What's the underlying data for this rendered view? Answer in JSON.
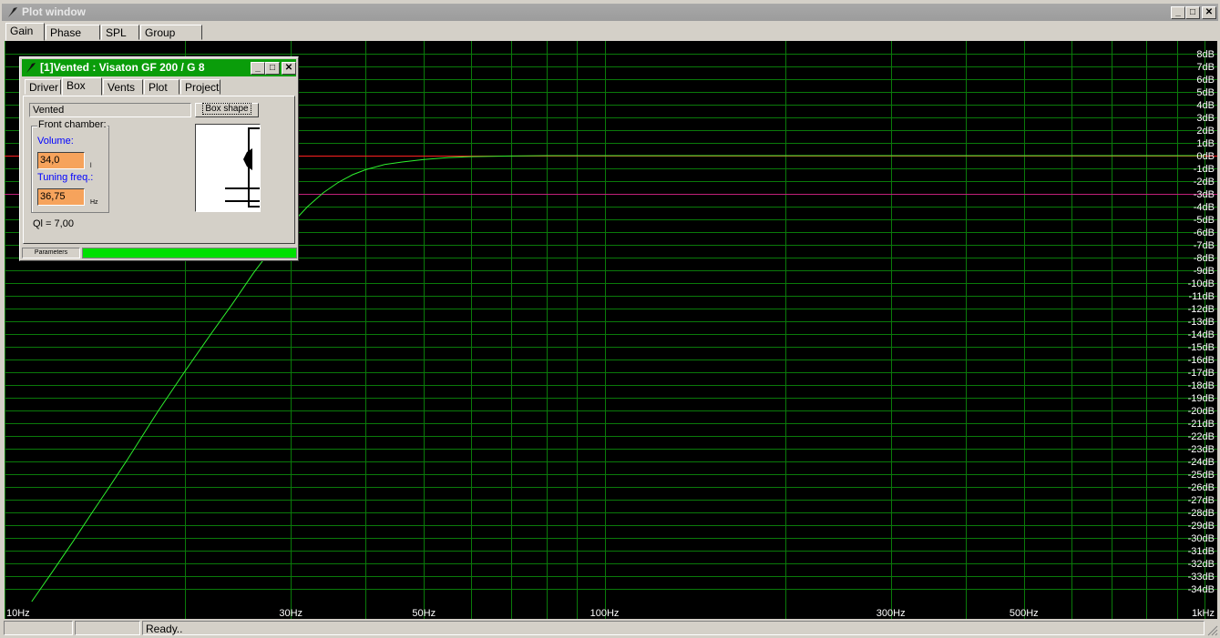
{
  "window": {
    "title": "Plot window",
    "min_label": "_",
    "max_label": "□",
    "close_label": "✕"
  },
  "tabs": [
    {
      "label": "Gain"
    },
    {
      "label": "Phase plot"
    },
    {
      "label": "SPL"
    },
    {
      "label": "Group delay"
    }
  ],
  "statusbar": {
    "panel3": "Ready.."
  },
  "child": {
    "title": "[1]Vented : Visaton GF 200 / G 8",
    "tabs": [
      {
        "label": "Driver"
      },
      {
        "label": "Box"
      },
      {
        "label": "Vents"
      },
      {
        "label": "Plot"
      },
      {
        "label": "Project"
      }
    ],
    "box_type": "Vented",
    "box_shape_button": "Box shape",
    "front_chamber_label": "Front chamber:",
    "volume_label": "Volume:",
    "volume_value": "34,0",
    "volume_unit": "l",
    "tuning_label": "Tuning freq.:",
    "tuning_value": "36,75",
    "tuning_unit": "Hz",
    "ql_text": "Ql = 7,00",
    "status_label": "Parameters"
  },
  "chart_data": {
    "type": "line",
    "x_scale": "log",
    "xlim": [
      10,
      1000
    ],
    "ylim": [
      -35,
      9
    ],
    "x_tick_labels": [
      {
        "x": 10,
        "label": "10Hz"
      },
      {
        "x": 30,
        "label": "30Hz"
      },
      {
        "x": 50,
        "label": "50Hz"
      },
      {
        "x": 100,
        "label": "100Hz"
      },
      {
        "x": 300,
        "label": "300Hz"
      },
      {
        "x": 500,
        "label": "500Hz"
      },
      {
        "x": 1000,
        "label": "1kHz"
      }
    ],
    "y_tick_labels": [
      "8dB",
      "7dB",
      "6dB",
      "5dB",
      "4dB",
      "3dB",
      "2dB",
      "1dB",
      "0dB",
      "-1dB",
      "-2dB",
      "-3dB",
      "-4dB",
      "-5dB",
      "-6dB",
      "-7dB",
      "-8dB",
      "-9dB",
      "-10dB",
      "-11dB",
      "-12dB",
      "-13dB",
      "-14dB",
      "-15dB",
      "-16dB",
      "-17dB",
      "-18dB",
      "-19dB",
      "-20dB",
      "-21dB",
      "-22dB",
      "-23dB",
      "-24dB",
      "-25dB",
      "-26dB",
      "-27dB",
      "-28dB",
      "-29dB",
      "-30dB",
      "-31dB",
      "-32dB",
      "-33dB",
      "-34dB"
    ],
    "reference_lines": [
      {
        "y": 0,
        "color": "#ff2020"
      },
      {
        "y": -3,
        "color": "#c0207a"
      }
    ],
    "grid": true,
    "colors": {
      "background": "#000000",
      "grid": "#0a7a0a",
      "curve": "#2ef02e",
      "text": "#ffffff"
    },
    "series": [
      {
        "color": "#2ef02e",
        "points": [
          [
            11.1,
            -35
          ],
          [
            12,
            -32.7
          ],
          [
            13,
            -30.3
          ],
          [
            14,
            -28
          ],
          [
            15,
            -25.9
          ],
          [
            16,
            -23.9
          ],
          [
            18,
            -20.1
          ],
          [
            20,
            -16.9
          ],
          [
            22,
            -14.1
          ],
          [
            24,
            -11.6
          ],
          [
            26,
            -9.2
          ],
          [
            28,
            -7.2
          ],
          [
            30,
            -5.4
          ],
          [
            32,
            -4.0
          ],
          [
            34,
            -2.9
          ],
          [
            36,
            -2.1
          ],
          [
            38,
            -1.5
          ],
          [
            40,
            -1.1
          ],
          [
            43,
            -0.7
          ],
          [
            46,
            -0.5
          ],
          [
            50,
            -0.3
          ],
          [
            55,
            -0.15
          ],
          [
            60,
            -0.08
          ],
          [
            70,
            -0.03
          ],
          [
            80,
            0
          ],
          [
            100,
            0
          ],
          [
            1000,
            0
          ]
        ]
      }
    ]
  }
}
